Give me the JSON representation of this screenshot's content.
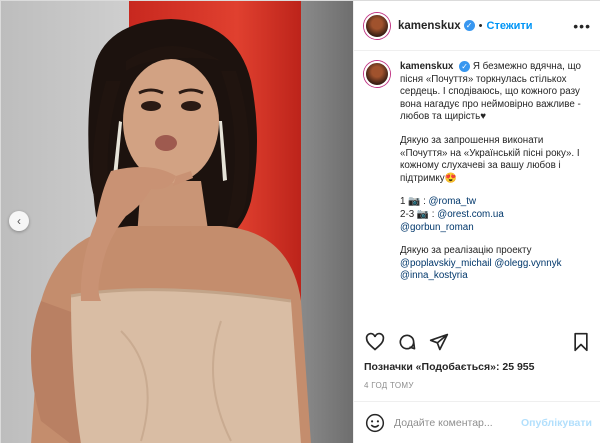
{
  "post": {
    "username": "kamenskux",
    "follow_label": "Стежити",
    "caption": {
      "author": "kamenskux",
      "p1": "Я безмежно вдячна, що пісня «Почуття» торкнулась стількох сердець. І сподіваюсь, що кожного разу вона нагадує про неймовірно важливе - любов та щирість♥",
      "p2": "Дякую за запрошення виконати «Почуття» на «Українській пісні року». І кожному слухачеві за вашу любов і підтримку😍",
      "credits": [
        {
          "prefix": "1 📷 : ",
          "handle": "@roma_tw"
        },
        {
          "prefix": "2-3 📷 : ",
          "handle": "@orest.com.ua"
        },
        {
          "prefix": "",
          "handle": "@gorbun_roman"
        }
      ],
      "p3": "Дякую за реалізацію проекту",
      "team": [
        {
          "handle": "@poplavskiy_michail",
          "sep": " "
        },
        {
          "handle": "@olegg.vynnyk",
          "sep": ""
        }
      ],
      "last_handle": "@inna_kostyria"
    },
    "likes_text": "Позначки «Подобається»: 25 955",
    "time_ago": "4 ГОД ТОМУ",
    "comment_placeholder": "Додайте коментар...",
    "publish_label": "Опублікувати"
  },
  "icons": {
    "verified": "verified-badge-icon",
    "more": "more-options-icon",
    "like": "heart-icon",
    "comment": "comment-icon",
    "share": "share-icon",
    "save": "bookmark-icon",
    "emoji": "emoji-icon",
    "prev": "chevron-left-icon"
  },
  "colors": {
    "link": "#00376b",
    "follow": "#0095f6",
    "verified": "#3897f0"
  }
}
